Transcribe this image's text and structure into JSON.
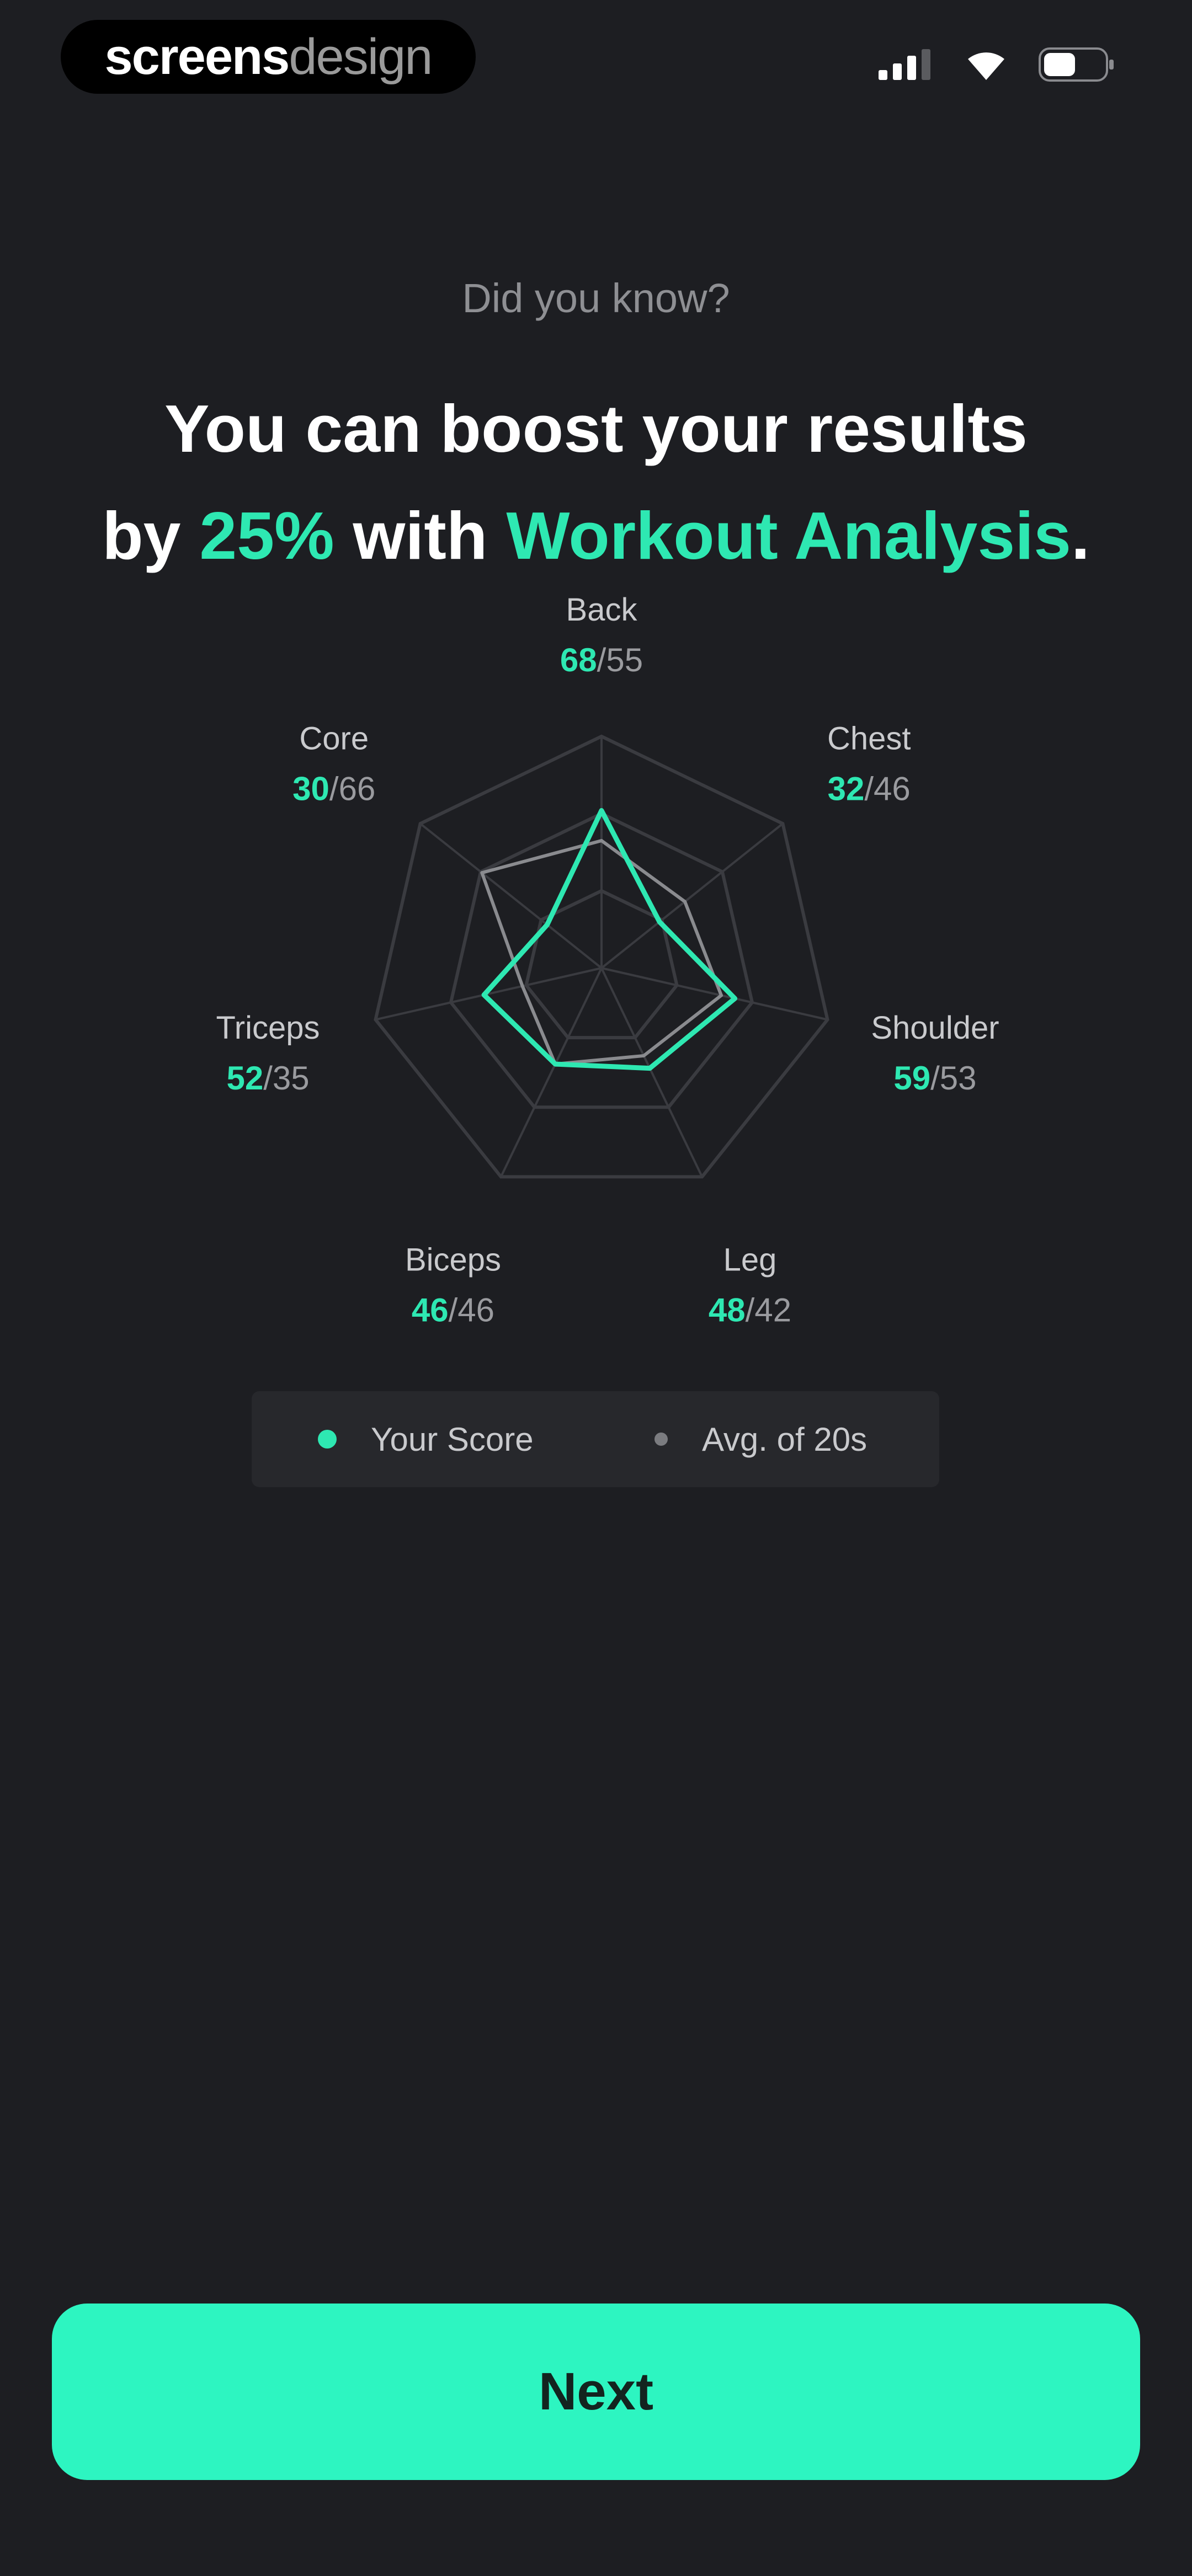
{
  "status_bar": {
    "brand_bold": "screens",
    "brand_light": "design",
    "icons": [
      "signal-icon",
      "wifi-icon",
      "battery-icon"
    ]
  },
  "header": {
    "eyebrow": "Did you know?",
    "line1": "You can boost your results",
    "line2_prefix": "by ",
    "line2_highlight1": "25%",
    "line2_mid": " with ",
    "line2_highlight2": "Workout Analysis",
    "line2_suffix": "."
  },
  "chart_data": {
    "type": "radar",
    "axes": [
      "Back",
      "Chest",
      "Shoulder",
      "Leg",
      "Biceps",
      "Triceps",
      "Core"
    ],
    "series": [
      {
        "name": "Your Score",
        "values": [
          68,
          32,
          59,
          48,
          46,
          52,
          30
        ]
      },
      {
        "name": "Avg. of 20s",
        "values": [
          55,
          46,
          53,
          42,
          46,
          35,
          66
        ]
      }
    ],
    "max": 100,
    "rings": 3,
    "colors": {
      "score": "#2ee8b2",
      "avg": "#8a8b8f",
      "grid": "#3a3b40"
    }
  },
  "legend": {
    "score_label": "Your Score",
    "avg_label": "Avg. of 20s"
  },
  "footer": {
    "next_label": "Next"
  },
  "theme": {
    "background": "#1d1e22",
    "accent": "#2ee8b2",
    "button": "#2df5c1"
  }
}
